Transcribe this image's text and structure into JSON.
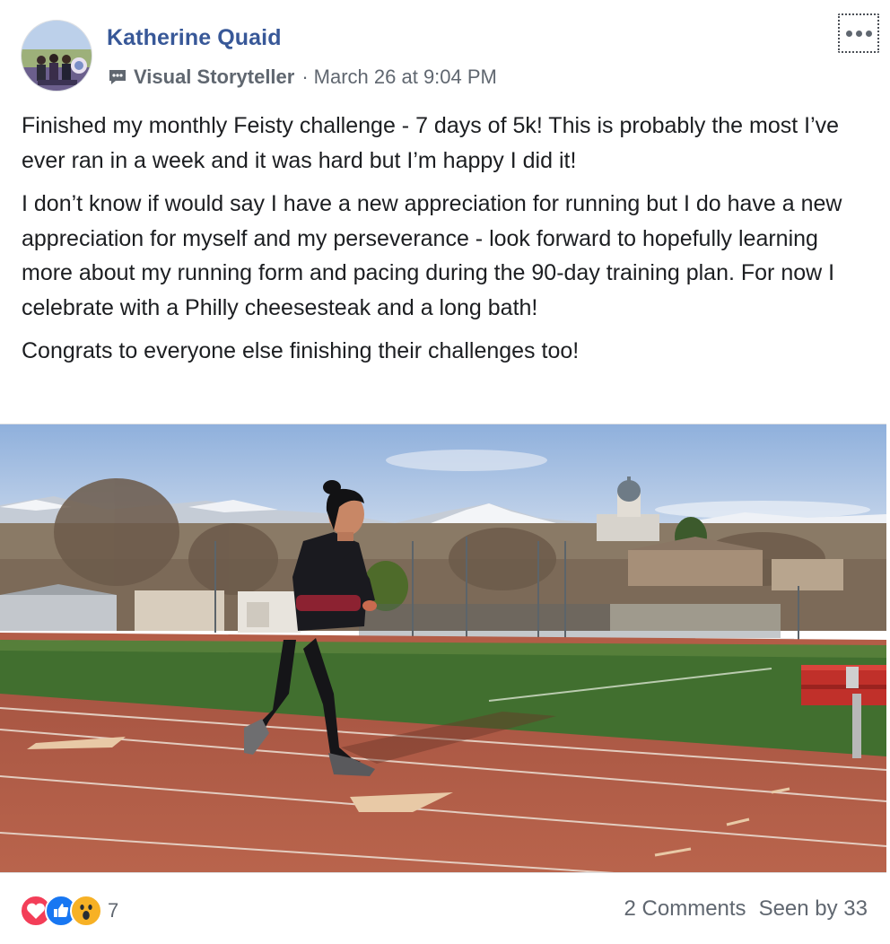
{
  "post": {
    "author": "Katherine Quaid",
    "badge_label": "Visual Storyteller",
    "badge_icon": "speech-bubble-icon",
    "separator": "·",
    "timestamp": "March 26 at 9:04 PM",
    "more_icon": "more-options-icon",
    "paragraphs": [
      "Finished my monthly Feisty challenge - 7 days of 5k! This is probably the most I’ve ever ran in a week and it was hard but I’m happy I did it!",
      "I don’t know if would say I have a new appreciation for running but I do have a new appreciation for myself and my perseverance - look forward to hopefully learning more about my running form and pacing during the 90-day training plan. For now I celebrate with a Philly cheesesteak and a long bath!",
      "Congrats to everyone else finishing their challenges too!"
    ]
  },
  "footer": {
    "reactions": [
      "love-reaction-icon",
      "like-reaction-icon",
      "wow-reaction-icon"
    ],
    "reaction_count": "7",
    "comments": "2 Comments",
    "seen_by": "Seen by 33"
  },
  "colors": {
    "author_link": "#385898",
    "secondary_text": "#606770",
    "love": "#f33e58",
    "like": "#1877f2",
    "wow": "#f7b125",
    "track": "#b55a45",
    "grass": "#3f6b2a",
    "sky": "#a9c4e4"
  }
}
